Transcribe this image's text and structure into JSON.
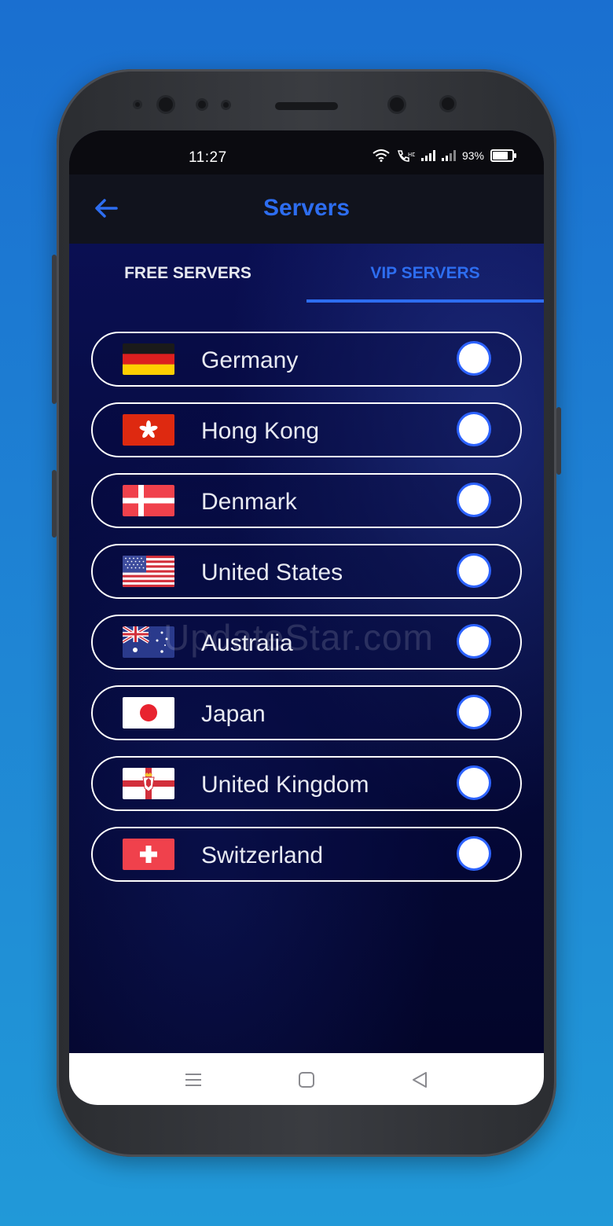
{
  "status_bar": {
    "time": "11:27",
    "battery": "93%",
    "battery_level": 0.93
  },
  "app_bar": {
    "title": "Servers"
  },
  "tabs": [
    {
      "label": "FREE SERVERS",
      "selected": false
    },
    {
      "label": "VIP SERVERS",
      "selected": true
    }
  ],
  "servers": [
    {
      "country": "Germany",
      "flag_icon": "germany-flag-icon"
    },
    {
      "country": "Hong Kong",
      "flag_icon": "hong-kong-flag-icon"
    },
    {
      "country": "Denmark",
      "flag_icon": "denmark-flag-icon"
    },
    {
      "country": "United States",
      "flag_icon": "united-states-flag-icon"
    },
    {
      "country": "Australia",
      "flag_icon": "australia-flag-icon"
    },
    {
      "country": "Japan",
      "flag_icon": "japan-flag-icon"
    },
    {
      "country": "United Kingdom",
      "flag_icon": "united-kingdom-flag-icon"
    },
    {
      "country": "Switzerland",
      "flag_icon": "switzerland-flag-icon"
    }
  ],
  "watermark": "UpdateStar.com",
  "colors": {
    "accent": "#2d6df0",
    "background_top": "#1a6fd0",
    "background_bottom": "#2199d8",
    "content_dark": "#04052a"
  }
}
